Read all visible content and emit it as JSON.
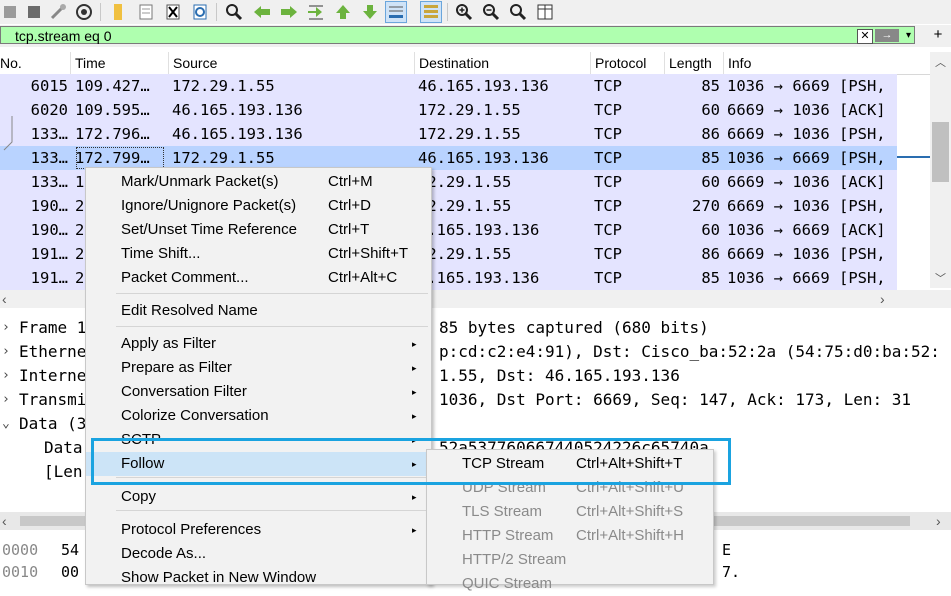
{
  "toolbar": {
    "icons": [
      "stop-capture-icon",
      "restart-icon",
      "capture-options-icon",
      "open-file-icon",
      "save-file-icon",
      "close-file-icon",
      "reload-icon",
      "find-packet-icon",
      "go-back-icon",
      "go-forward-icon",
      "go-to-packet-icon",
      "first-packet-icon",
      "last-packet-icon",
      "auto-scroll-icon",
      "colorize-icon",
      "zoom-in-icon",
      "zoom-out-icon",
      "normal-size-icon",
      "resize-columns-icon"
    ]
  },
  "filter": {
    "value": "tcp.stream eq 0",
    "color": "#afffaf",
    "clear_glyph": "✕",
    "apply_glyph": "→",
    "dropdown_glyph": "▾",
    "add_glyph": "+"
  },
  "packet_list": {
    "headers": [
      "No.",
      "Time",
      "Source",
      "Destination",
      "Protocol",
      "Length",
      "Info"
    ],
    "rows": [
      {
        "no": "6015",
        "time": "109.427…",
        "src": "172.29.1.55",
        "dst": "46.165.193.136",
        "proto": "TCP",
        "len": "85",
        "info": "1036 → 6669 [PSH,"
      },
      {
        "no": "6020",
        "time": "109.595…",
        "src": "46.165.193.136",
        "dst": "172.29.1.55",
        "proto": "TCP",
        "len": "60",
        "info": "6669 → 1036 [ACK]"
      },
      {
        "no": "133…",
        "time": "172.796…",
        "src": "46.165.193.136",
        "dst": "172.29.1.55",
        "proto": "TCP",
        "len": "86",
        "info": "6669 → 1036 [PSH,"
      },
      {
        "no": "133…",
        "time": "172.799…",
        "src": "172.29.1.55",
        "dst": "46.165.193.136",
        "proto": "TCP",
        "len": "85",
        "info": "1036 → 6669 [PSH,"
      },
      {
        "no": "133…",
        "time": "1",
        "src": "",
        "dst": "72.29.1.55",
        "proto": "TCP",
        "len": "60",
        "info": "6669 → 1036 [ACK]"
      },
      {
        "no": "190…",
        "time": "2",
        "src": "",
        "dst": "72.29.1.55",
        "proto": "TCP",
        "len": "270",
        "info": "6669 → 1036 [PSH,"
      },
      {
        "no": "190…",
        "time": "2",
        "src": "",
        "dst": "5.165.193.136",
        "proto": "TCP",
        "len": "60",
        "info": "1036 → 6669 [ACK]"
      },
      {
        "no": "191…",
        "time": "2",
        "src": "",
        "dst": "72.29.1.55",
        "proto": "TCP",
        "len": "86",
        "info": "6669 → 1036 [PSH,"
      },
      {
        "no": "191…",
        "time": "2",
        "src": "",
        "dst": "5.165.193.136",
        "proto": "TCP",
        "len": "85",
        "info": "1036 → 6669 [PSH,"
      }
    ],
    "selected_index": 3,
    "row_color": "#e4e4ff",
    "selected_color": "#b9d3ff"
  },
  "details": {
    "lines": [
      {
        "expander": "›",
        "text": "Frame 1",
        "tail": "85 bytes captured (680 bits)"
      },
      {
        "expander": "›",
        "text": "Etherne",
        "tail": "p:cd:c2:e4:91), Dst: Cisco_ba:52:2a (54:75:d0:ba:52:"
      },
      {
        "expander": "›",
        "text": "Interne",
        "tail": "1.55, Dst: 46.165.193.136"
      },
      {
        "expander": "›",
        "text": "Transmi",
        "tail": "1036, Dst Port: 6669, Seq: 147, Ack: 173, Len: 31"
      },
      {
        "expander": "⌄",
        "text": "Data (3",
        "tail": ""
      },
      {
        "expander": "",
        "text": "Data",
        "tail": "52a537760667440524226c65740a"
      },
      {
        "expander": "",
        "text": "[Len",
        "tail": ""
      }
    ]
  },
  "hex": {
    "lines": [
      {
        "offset": "0000",
        "bytes": "54",
        "ascii": "E"
      },
      {
        "offset": "0010",
        "bytes": "00",
        "ascii": "7."
      }
    ]
  },
  "context_menu": {
    "items": [
      {
        "label": "Mark/Unmark Packet(s)",
        "shortcut": "Ctrl+M",
        "submenu": false
      },
      {
        "label": "Ignore/Unignore Packet(s)",
        "shortcut": "Ctrl+D",
        "submenu": false
      },
      {
        "label": "Set/Unset Time Reference",
        "shortcut": "Ctrl+T",
        "submenu": false
      },
      {
        "label": "Time Shift...",
        "shortcut": "Ctrl+Shift+T",
        "submenu": false
      },
      {
        "label": "Packet Comment...",
        "shortcut": "Ctrl+Alt+C",
        "submenu": false
      },
      {
        "label": "Edit Resolved Name",
        "shortcut": "",
        "submenu": false
      },
      {
        "label": "Apply as Filter",
        "shortcut": "",
        "submenu": true
      },
      {
        "label": "Prepare as Filter",
        "shortcut": "",
        "submenu": true
      },
      {
        "label": "Conversation Filter",
        "shortcut": "",
        "submenu": true
      },
      {
        "label": "Colorize Conversation",
        "shortcut": "",
        "submenu": true
      },
      {
        "label": "SCTP",
        "shortcut": "",
        "submenu": true
      },
      {
        "label": "Follow",
        "shortcut": "",
        "submenu": true
      },
      {
        "label": "Copy",
        "shortcut": "",
        "submenu": true
      },
      {
        "label": "Protocol Preferences",
        "shortcut": "",
        "submenu": true
      },
      {
        "label": "Decode As...",
        "shortcut": "",
        "submenu": false
      },
      {
        "label": "Show Packet in New Window",
        "shortcut": "",
        "submenu": false
      }
    ],
    "highlighted": "Follow",
    "submenu_arrow": "▸"
  },
  "follow_submenu": {
    "items": [
      {
        "label": "TCP Stream",
        "shortcut": "Ctrl+Alt+Shift+T",
        "enabled": true
      },
      {
        "label": "UDP Stream",
        "shortcut": "Ctrl+Alt+Shift+U",
        "enabled": false
      },
      {
        "label": "TLS Stream",
        "shortcut": "Ctrl+Alt+Shift+S",
        "enabled": false
      },
      {
        "label": "HTTP Stream",
        "shortcut": "Ctrl+Alt+Shift+H",
        "enabled": false
      },
      {
        "label": "HTTP/2 Stream",
        "shortcut": "",
        "enabled": false
      },
      {
        "label": "QUIC Stream",
        "shortcut": "",
        "enabled": false
      }
    ]
  },
  "annotation": {
    "highlight_color": "#1aa3e0"
  }
}
